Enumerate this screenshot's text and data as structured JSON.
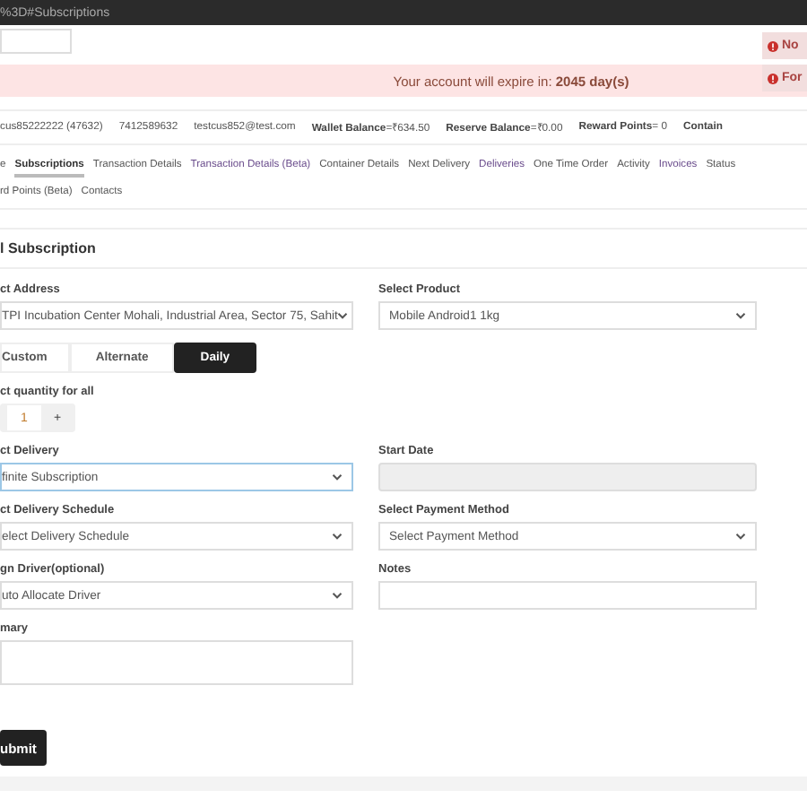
{
  "address_bar": {
    "url": "%3D#Subscriptions"
  },
  "alerts": [
    {
      "text": "No"
    },
    {
      "text": "For"
    }
  ],
  "banner": {
    "text": "Your account will expire in: **2045 day(s)**"
  },
  "customer_info": [
    {
      "value": "cus85222222 (47632)"
    },
    {
      "value": "7412589632"
    },
    {
      "value": "testcus852@test.com"
    },
    {
      "label": "Wallet Balance",
      "value": "=₹634.50"
    },
    {
      "label": "Reserve Balance",
      "value": "=₹0.00"
    },
    {
      "label": "Reward Points",
      "value": "= 0"
    },
    {
      "label": "Contain"
    }
  ],
  "tabs": [
    {
      "label": "e",
      "selected": false,
      "visited": false
    },
    {
      "label": "Subscriptions",
      "selected": true,
      "visited": false
    },
    {
      "label": "Transaction Details",
      "selected": false,
      "visited": false
    },
    {
      "label": "Transaction Details (Beta)",
      "selected": false,
      "visited": true
    },
    {
      "label": "Container Details",
      "selected": false,
      "visited": false
    },
    {
      "label": "Next Delivery",
      "selected": false,
      "visited": false
    },
    {
      "label": "Deliveries",
      "selected": false,
      "visited": true
    },
    {
      "label": "One Time Order",
      "selected": false,
      "visited": false
    },
    {
      "label": "Activity",
      "selected": false,
      "visited": false
    },
    {
      "label": "Invoices",
      "selected": false,
      "visited": true
    },
    {
      "label": "Status",
      "selected": false,
      "visited": false
    },
    {
      "label": "rd Points (Beta)",
      "selected": false,
      "visited": false
    },
    {
      "label": "Contacts",
      "selected": false,
      "visited": false
    }
  ],
  "form": {
    "title": "l Subscription",
    "rows": [
      [
        {
          "kind": "select",
          "label": "ct Address",
          "value": "TPI Incubation Center Mohali, Industrial Area, Sector 75, Sahit",
          "focused": false
        },
        {
          "kind": "select",
          "label": "Select Product",
          "value": "Mobile Android1 1kg",
          "focused": false
        }
      ],
      [
        {
          "kind": "buttons",
          "options": [
            {
              "label": "Custom",
              "selected": false
            },
            {
              "label": "Alternate",
              "selected": false
            },
            {
              "label": "Daily",
              "selected": true
            }
          ]
        }
      ],
      [
        {
          "kind": "stepper",
          "label": "ct quantity for all",
          "value": "1",
          "increment": "+"
        }
      ],
      [
        {
          "kind": "select",
          "label": "ct Delivery",
          "value": "finite Subscription",
          "focused": true
        },
        {
          "kind": "date",
          "label": "Start Date",
          "disabled": true
        }
      ],
      [
        {
          "kind": "select",
          "label": "ct Delivery Schedule",
          "value": "elect Delivery Schedule",
          "focused": false
        },
        {
          "kind": "select",
          "label": "Select Payment Method",
          "value": "Select Payment Method",
          "focused": false
        }
      ],
      [
        {
          "kind": "select",
          "label": "gn Driver(optional)",
          "value": "uto Allocate Driver",
          "focused": false
        },
        {
          "kind": "textarea",
          "label": "Notes",
          "tall": false
        }
      ],
      [
        {
          "kind": "textarea",
          "label": "mary",
          "tall": true
        }
      ]
    ],
    "submit": "ubmit"
  }
}
